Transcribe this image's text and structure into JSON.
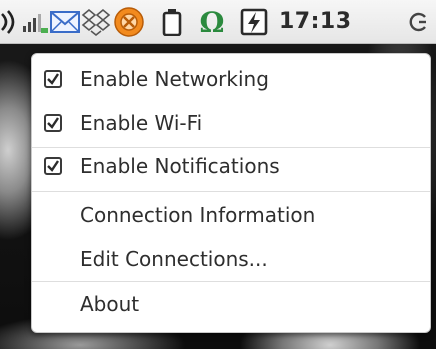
{
  "panel": {
    "clock": "17:13",
    "icons": [
      "sound-icon",
      "network-signal-icon",
      "mail-icon",
      "dropbox-icon",
      "update-notifier-icon",
      "battery-icon",
      "omega-icon",
      "power-icon",
      "power-menu-icon"
    ]
  },
  "menu": {
    "items": [
      {
        "label": "Enable Networking",
        "checked": true
      },
      {
        "label": "Enable Wi-Fi",
        "checked": true
      },
      {
        "label": "Enable Notifications",
        "checked": true
      },
      {
        "label": "Connection Information"
      },
      {
        "label": "Edit Connections..."
      },
      {
        "label": "About"
      }
    ]
  },
  "colors": {
    "panel_bg": "#eeeeee",
    "menu_bg": "#ffffff",
    "text": "#2e2e2e",
    "mail_blue": "#3a6cc8",
    "update_orange": "#f28a1e",
    "omega_green": "#2b8a3e"
  }
}
